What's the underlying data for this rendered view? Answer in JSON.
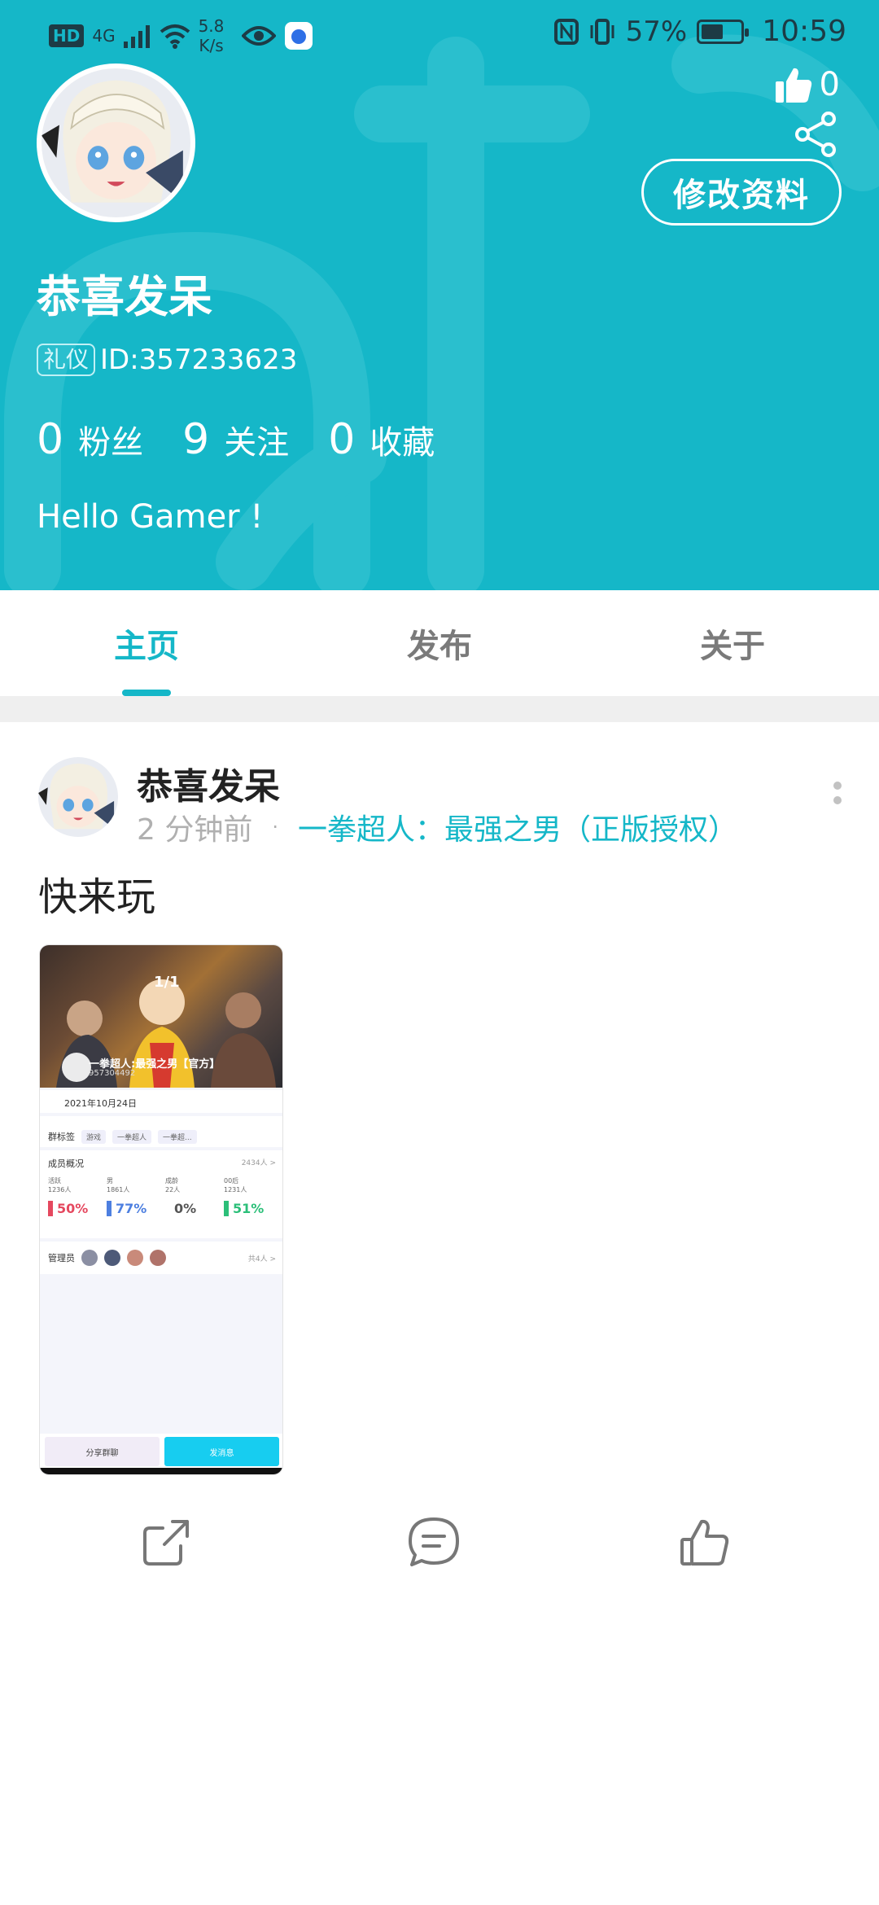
{
  "status_bar": {
    "network": "4G",
    "hd": "HD",
    "speed_value": "5.8",
    "speed_unit": "K/s",
    "battery": "57%",
    "battery_level": 0.57,
    "time": "10:59"
  },
  "profile": {
    "nickname": "恭喜发呆",
    "badge": "礼仪",
    "id": "ID:357233623",
    "likes": "0",
    "edit_label": "修改资料",
    "stats": [
      {
        "num": "0",
        "label": "粉丝"
      },
      {
        "num": "9",
        "label": "关注"
      },
      {
        "num": "0",
        "label": "收藏"
      }
    ],
    "bio": "Hello Gamer !"
  },
  "tabs": [
    {
      "label": "主页",
      "active": true
    },
    {
      "label": "发布",
      "active": false
    },
    {
      "label": "关于",
      "active": false
    }
  ],
  "post": {
    "author": "恭喜发呆",
    "time": "2 分钟前",
    "dot": "·",
    "game": "一拳超人：最强之男（正版授权）",
    "text": "快来玩",
    "thumbnail": {
      "page": "1/1",
      "title": "一拳超人:最强之男【官方】",
      "sub": "957304492",
      "date": "2021年10月24日",
      "tags_label": "群标签",
      "tags": [
        "游戏",
        "一拳超人",
        "一拳超..."
      ],
      "members_label": "成员概况",
      "members_count": "2434人 >",
      "bars": [
        {
          "cap1": "活跃",
          "cap2": "1236人",
          "pct": "50%",
          "color": "#e5485f"
        },
        {
          "cap1": "男",
          "cap2": "1861人",
          "pct": "77%",
          "color": "#4d7fe0"
        },
        {
          "cap1": "成龄",
          "cap2": "22人",
          "pct": "0%",
          "color": "#555555"
        },
        {
          "cap1": "00后",
          "cap2": "1231人",
          "pct": "51%",
          "color": "#2cbf79"
        }
      ],
      "admins_label": "管理员",
      "admins_count": "共4人 >",
      "share_label": "分享群聊",
      "send_label": "发消息"
    }
  },
  "actions": [
    {
      "icon": "share-external-icon"
    },
    {
      "icon": "comment-icon"
    },
    {
      "icon": "thumbs-up-icon"
    }
  ],
  "colors": {
    "accent": "#15b7c8",
    "header_bg": "#15b7c8",
    "gap_bg": "#efefef"
  }
}
